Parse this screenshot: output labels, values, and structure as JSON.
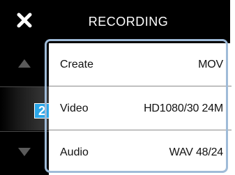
{
  "header": {
    "title": "RECORDING",
    "close_icon": "close-icon"
  },
  "side": {
    "up_icon": "up-arrow-icon",
    "down_icon": "down-arrow-icon"
  },
  "callout": {
    "label": "2",
    "color": "#2aa6e8"
  },
  "menu": {
    "items": [
      {
        "label": "Create",
        "value": "MOV"
      },
      {
        "label": "Video",
        "value": "HD1080/30 24M"
      },
      {
        "label": "Audio",
        "value": "WAV 48/24"
      }
    ]
  },
  "colors": {
    "background": "#000000",
    "list_background": "#ffffff",
    "highlight_border": "#9fbbd8"
  }
}
